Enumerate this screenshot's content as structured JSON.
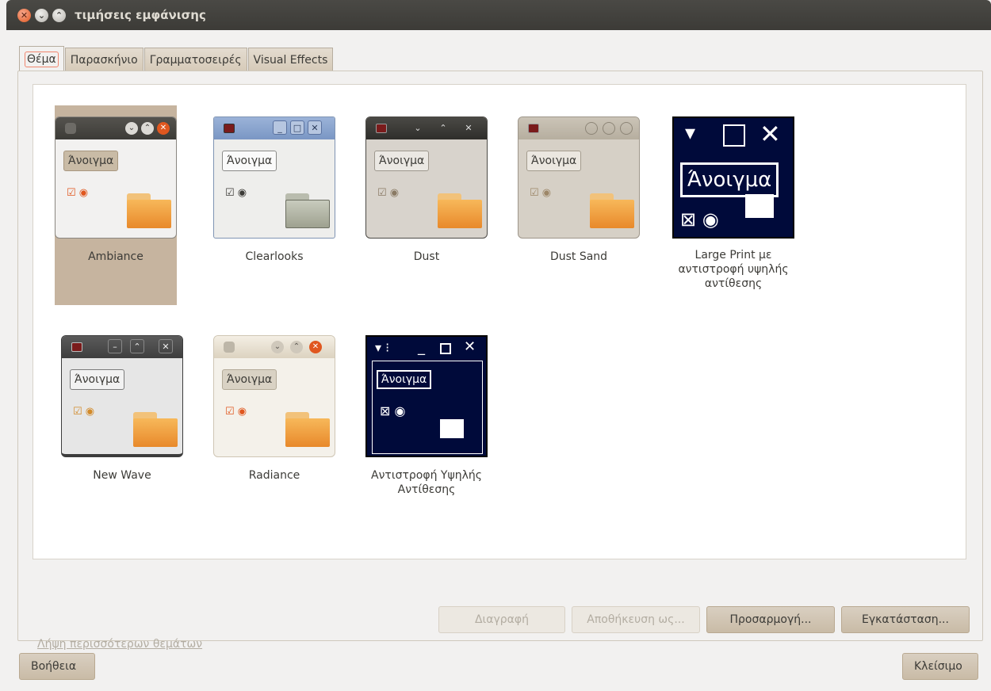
{
  "window": {
    "title": "τιμήσεις εμφάνισης"
  },
  "tabs": [
    {
      "label": "Θέμα",
      "active": true
    },
    {
      "label": "Παρασκήνιο",
      "active": false
    },
    {
      "label": "Γραμματοσειρές",
      "active": false
    },
    {
      "label": "Visual Effects",
      "active": false
    }
  ],
  "themes": {
    "sample_button_label": "Άνοιγμα",
    "items": [
      {
        "name": "Ambiance",
        "selected": true
      },
      {
        "name": "Clearlooks",
        "selected": false
      },
      {
        "name": "Dust",
        "selected": false
      },
      {
        "name": "Dust Sand",
        "selected": false
      },
      {
        "name": "Large Print με αντιστροφή υψηλής αντίθεσης",
        "selected": false
      },
      {
        "name": "New Wave",
        "selected": false
      },
      {
        "name": "Radiance",
        "selected": false
      },
      {
        "name": "Αντιστροφή Υψηλής Αντίθεσης",
        "selected": false
      }
    ]
  },
  "actions": {
    "delete_label": "Διαγραφή",
    "save_as_label": "Αποθήκευση ως...",
    "customize_label": "Προσαρμογή...",
    "install_label": "Εγκατάσταση..."
  },
  "more_themes_link": "Λήψη περισσότερων θεμάτων",
  "footer": {
    "help_label": "Βοήθεια",
    "close_label": "Κλείσιμο"
  },
  "colors": {
    "selection": "#c6b49f",
    "accent_orange": "#e0571f"
  }
}
